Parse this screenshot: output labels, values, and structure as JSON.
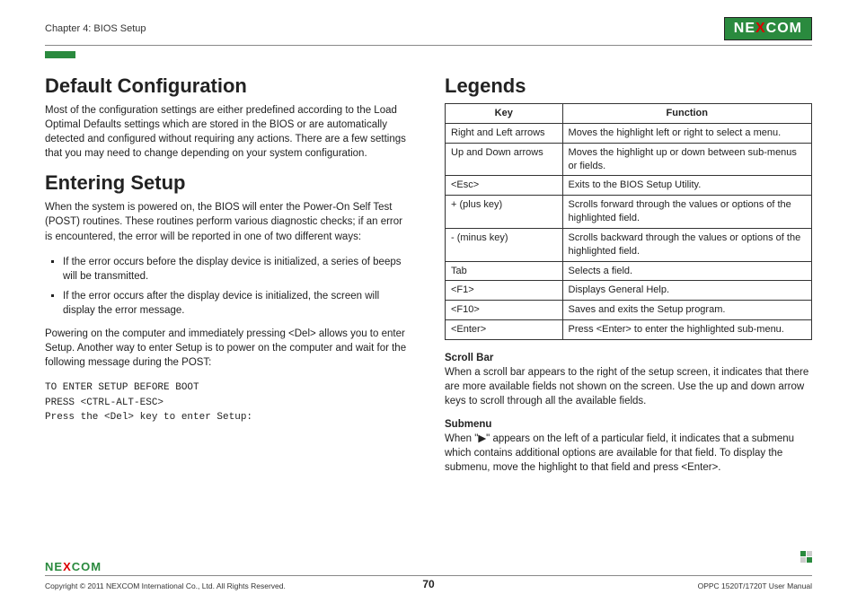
{
  "header": {
    "chapter": "Chapter 4: BIOS Setup",
    "brand": "NEXCOM"
  },
  "left": {
    "h1a": "Default Configuration",
    "p1": "Most of the configuration settings are either predefined according to the Load Optimal Defaults settings which are stored in the BIOS or are automatically detected and configured without requiring any actions. There are a few settings that you may need to change depending on your system configuration.",
    "h1b": "Entering Setup",
    "p2": "When the system is powered on, the BIOS will enter the Power-On Self Test (POST) routines. These routines perform various diagnostic checks; if an error is encountered, the error will be reported in one of two different ways:",
    "li1": "If the error occurs before the display device is initialized, a series of beeps will be transmitted.",
    "li2": "If the error occurs after the display device is initialized, the screen will display the error message.",
    "p3": "Powering on the computer and immediately pressing <Del> allows you to enter Setup. Another way to enter Setup is to power on the computer and wait for the following message during the POST:",
    "code": "TO ENTER SETUP BEFORE BOOT\nPRESS <CTRL-ALT-ESC>\nPress the <Del> key to enter Setup:"
  },
  "right": {
    "h1": "Legends",
    "th_key": "Key",
    "th_func": "Function",
    "rows": [
      {
        "k": "Right and Left arrows",
        "f": "Moves the highlight left or right to select a menu."
      },
      {
        "k": "Up and Down arrows",
        "f": "Moves the highlight up or down between sub-menus or fields."
      },
      {
        "k": "<Esc>",
        "f": "Exits to the BIOS Setup Utility."
      },
      {
        "k": "+ (plus key)",
        "f": "Scrolls forward through the values or options of the highlighted field."
      },
      {
        "k": "- (minus key)",
        "f": "Scrolls backward through the values or options of the highlighted field."
      },
      {
        "k": "Tab",
        "f": "Selects a field."
      },
      {
        "k": "<F1>",
        "f": "Displays General Help."
      },
      {
        "k": "<F10>",
        "f": "Saves and exits the Setup program."
      },
      {
        "k": "<Enter>",
        "f": "Press <Enter> to enter the highlighted sub-menu."
      }
    ],
    "scroll_h": "Scroll Bar",
    "scroll_p": "When a scroll bar appears to the right of the setup screen, it indicates that there are more available fields not shown on the screen. Use the up and down arrow keys to scroll through all the available fields.",
    "sub_h": "Submenu",
    "sub_p": "When \"▶\" appears on the left of a particular field, it indicates that a submenu which contains additional options are available for that field. To display the submenu, move the highlight to that field and press <Enter>."
  },
  "footer": {
    "copyright": "Copyright © 2011 NEXCOM International Co., Ltd. All Rights Reserved.",
    "page": "70",
    "doc": "OPPC 1520T/1720T User Manual"
  }
}
